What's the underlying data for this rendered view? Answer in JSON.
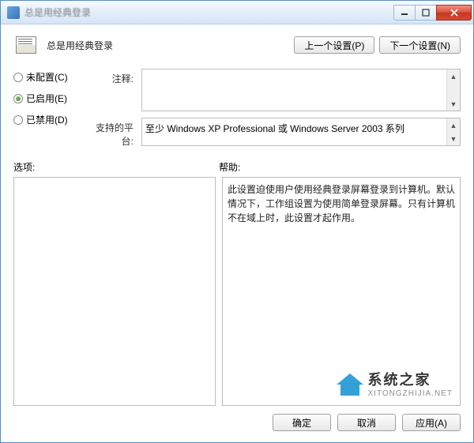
{
  "window": {
    "title": "总是用经典登录"
  },
  "header": {
    "policy_title": "总是用经典登录",
    "prev_button": "上一个设置(P)",
    "next_button": "下一个设置(N)"
  },
  "radios": {
    "not_configured": "未配置(C)",
    "enabled": "已启用(E)",
    "disabled": "已禁用(D)",
    "selected": "enabled"
  },
  "fields": {
    "comment_label": "注释:",
    "comment_value": "",
    "platform_label": "支持的平台:",
    "platform_value": "至少 Windows XP Professional 或 Windows Server 2003 系列"
  },
  "labels": {
    "options": "选项:",
    "help": "帮助:"
  },
  "help_text": "此设置迫使用户使用经典登录屏幕登录到计算机。默认情况下，工作组设置为使用简单登录屏幕。只有计算机不在域上时，此设置才起作用。",
  "footer": {
    "ok": "确定",
    "cancel": "取消",
    "apply": "应用(A)"
  },
  "watermark": {
    "name": "系统之家",
    "url": "XITONGZHIJIA.NET"
  }
}
